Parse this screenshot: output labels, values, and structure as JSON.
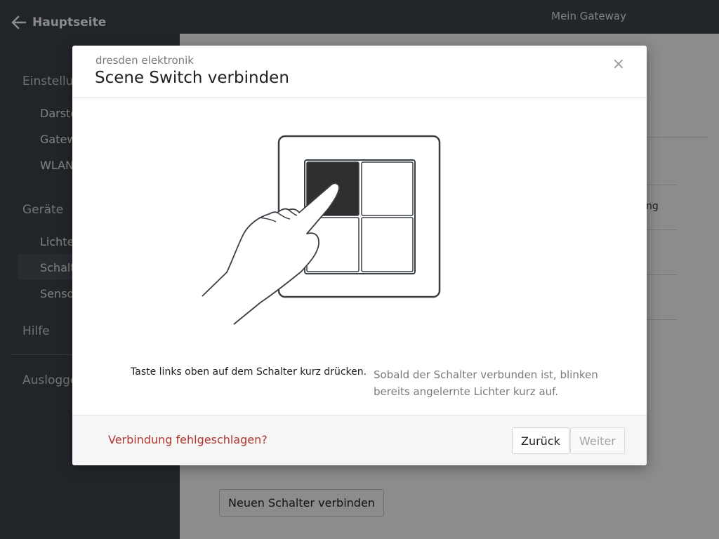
{
  "sidebar": {
    "home_label": "Hauptseite",
    "section_settings": "Einstellungen",
    "items_settings": [
      "Darstellung",
      "Gateway",
      "WLAN"
    ],
    "section_devices": "Geräte",
    "items_devices": [
      "Lichter",
      "Schalter",
      "Sensoren"
    ],
    "help": "Hilfe",
    "logout": "Ausloggen"
  },
  "topbar": {
    "title": "Mein Gateway"
  },
  "main": {
    "peek_text": "ng",
    "new_switch_button": "Neuen Schalter verbinden"
  },
  "modal": {
    "brand": "dresden elektronik",
    "title": "Scene Switch verbinden",
    "close_symbol": "×",
    "instruction": "Taste links oben auf dem Schalter kurz drücken.",
    "info": "Sobald der Schalter verbunden ist, blinken bereits angelernte Lichter kurz auf.",
    "fail_link": "Verbindung fehlgeschlagen?",
    "back_button": "Zurück",
    "next_button": "Weiter"
  },
  "colors": {
    "sidebar_bg": "#3c434b",
    "link_red": "#b0352e",
    "active_key": "#2f2f2f"
  },
  "icons": {
    "home": "arrow-left-icon",
    "close": "close-icon"
  }
}
